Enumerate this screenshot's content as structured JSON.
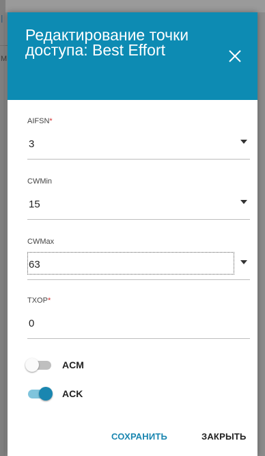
{
  "modal": {
    "title": "Редактирование точки доступа: Best Effort",
    "close_icon": "close-icon",
    "header_color": "#0d8bb3"
  },
  "fields": {
    "aifsn": {
      "label": "AIFSN",
      "required_mark": "*",
      "value": "3"
    },
    "cwmin": {
      "label": "CWMin",
      "value": "15"
    },
    "cwmax": {
      "label": "CWMax",
      "value": "63"
    },
    "txop": {
      "label": "TXOP",
      "required_mark": "*",
      "value": "0"
    }
  },
  "toggles": {
    "acm": {
      "label": "ACM",
      "checked": false
    },
    "ack": {
      "label": "ACK",
      "checked": true
    }
  },
  "footer": {
    "save_label": "СОХРАНИТЬ",
    "close_label": "ЗАКРЫТЬ",
    "save_color": "#1a86b0",
    "close_color": "#222222"
  },
  "background": {
    "glyph_1": "l",
    "glyph_2": "M"
  }
}
